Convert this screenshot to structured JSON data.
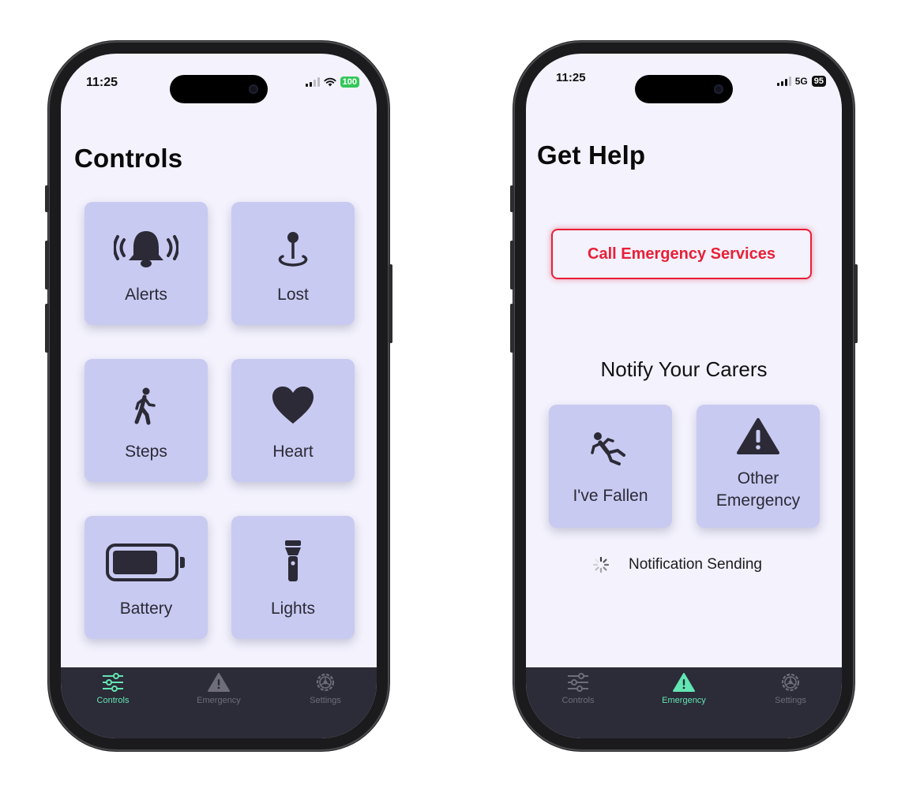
{
  "left_phone": {
    "status": {
      "time": "11:25",
      "battery": "100"
    },
    "title": "Controls",
    "tiles": [
      {
        "label": "Alerts",
        "icon": "bell-ringing-icon"
      },
      {
        "label": "Lost",
        "icon": "location-pin-icon"
      },
      {
        "label": "Steps",
        "icon": "walking-person-icon"
      },
      {
        "label": "Heart",
        "icon": "heart-icon"
      },
      {
        "label": "Battery",
        "icon": "battery-icon"
      },
      {
        "label": "Lights",
        "icon": "flashlight-icon"
      }
    ],
    "tabs": [
      {
        "label": "Controls",
        "active": true
      },
      {
        "label": "Emergency",
        "active": false
      },
      {
        "label": "Settings",
        "active": false
      }
    ]
  },
  "right_phone": {
    "status": {
      "time": "11:25",
      "network": "5G",
      "battery": "95"
    },
    "title": "Get Help",
    "call_button": "Call Emergency Services",
    "notify_title": "Notify Your Carers",
    "tiles": [
      {
        "label": "I've Fallen",
        "icon": "falling-person-icon"
      },
      {
        "label": "Other Emergency",
        "icon": "warning-triangle-icon"
      }
    ],
    "sending_text": "Notification Sending",
    "tabs": [
      {
        "label": "Controls",
        "active": false
      },
      {
        "label": "Emergency",
        "active": true
      },
      {
        "label": "Settings",
        "active": false
      }
    ]
  },
  "colors": {
    "screen_bg": "#f3f2fd",
    "tile_bg": "#c8caf1",
    "tabbar_bg": "#2c2b38",
    "tab_active": "#62e6b3",
    "tab_inactive": "#6e6d79",
    "emergency_red": "#e91f37"
  }
}
